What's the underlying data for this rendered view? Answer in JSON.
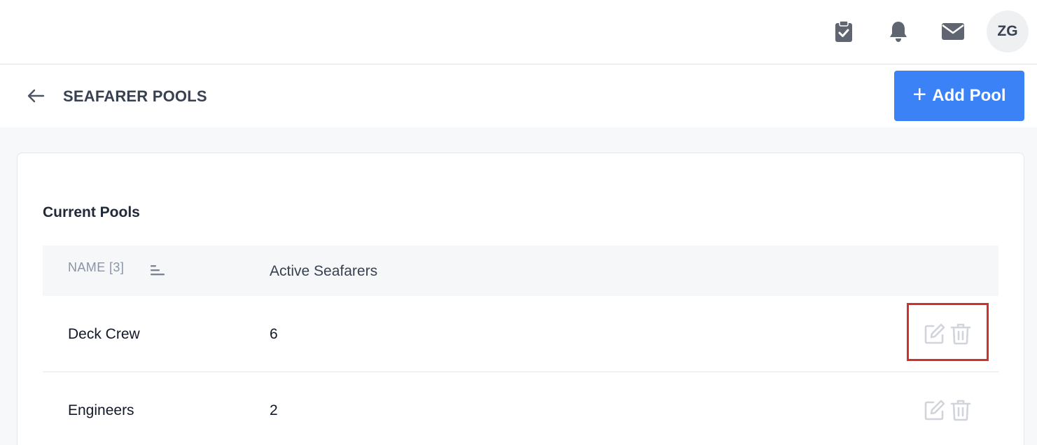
{
  "topbar": {
    "icons": [
      "clipboard-check-icon",
      "bell-icon",
      "mail-icon"
    ],
    "avatar_initials": "ZG"
  },
  "header": {
    "title": "SEAFARER POOLS",
    "add_button_label": "Add Pool"
  },
  "section": {
    "title": "Current Pools"
  },
  "table": {
    "columns": [
      "NAME [3]",
      "Active Seafarers"
    ],
    "rows": [
      {
        "name": "Deck Crew",
        "active": "6"
      },
      {
        "name": "Engineers",
        "active": "2"
      }
    ]
  },
  "colors": {
    "accent": "#3b82f6",
    "highlight": "#d32f2f",
    "action_icon": "#d1d5db"
  }
}
